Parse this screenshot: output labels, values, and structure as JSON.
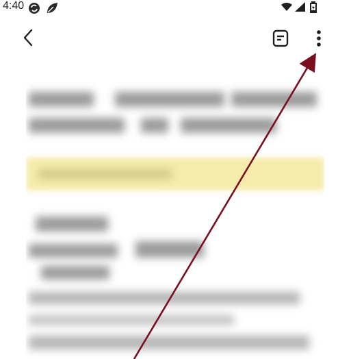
{
  "status_bar": {
    "time": "4:40",
    "left_icons": [
      "sync-icon",
      "leaf-icon"
    ],
    "right_icons": [
      "wifi-icon",
      "signal-icon",
      "battery-icon"
    ]
  },
  "toolbar": {
    "back_icon": "chevron-left-icon",
    "reader_icon": "document-view-icon",
    "more_icon": "more-vertical-icon"
  },
  "document": {
    "content_state": "blurred",
    "highlight_color": "#f5ecac"
  },
  "annotation": {
    "arrow_color": "#7a0f1f",
    "target": "more-options-button"
  }
}
